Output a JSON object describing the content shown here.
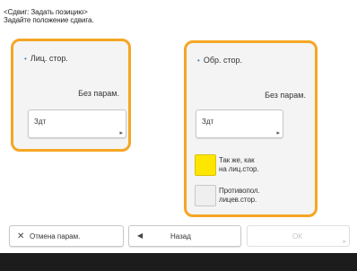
{
  "header": {
    "line1": "<Сдвиг: Задать позицию>",
    "line2": "Задайте положение сдвига."
  },
  "front": {
    "title": "Лиц. стор.",
    "status": "Без парам.",
    "set_label": "Здт"
  },
  "back": {
    "title": "Обр. стор.",
    "status": "Без парам.",
    "set_label": "Здт",
    "option_same_line1": "Так же, как",
    "option_same_line2": "на лиц.стор.",
    "option_opposite_line1": "Противопол.",
    "option_opposite_line2": "лицев.стор."
  },
  "footer": {
    "cancel_label": "Отмена парам.",
    "back_label": "Назад",
    "ok_label": "OK"
  },
  "colors": {
    "selection_border": "#f5a623",
    "same_swatch": "#ffe600",
    "bullet": "#3a87c8"
  }
}
